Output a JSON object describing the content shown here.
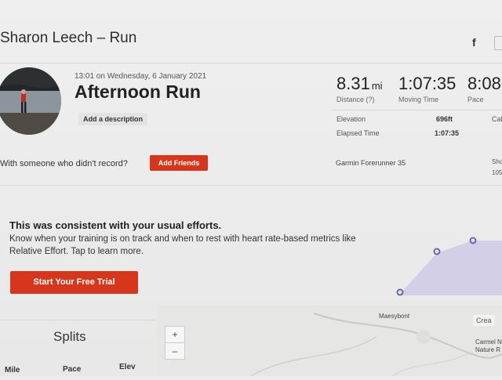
{
  "header": {
    "title": "Sharon Leech – Run",
    "share_icon": "f"
  },
  "activity": {
    "datetime": "13:01 on Wednesday, 6 January 2021",
    "title": "Afternoon Run",
    "add_description": "Add a description"
  },
  "stats": {
    "distance": {
      "value": "8.31",
      "unit": "mi",
      "label": "Distance (?)"
    },
    "moving_time": {
      "value": "1:07:35",
      "label": "Moving Time"
    },
    "pace": {
      "value": "8:08",
      "label": "Pace"
    }
  },
  "details": {
    "elevation_label": "Elevation",
    "elevation_value": "696ft",
    "elapsed_label": "Elapsed Time",
    "elapsed_value": "1:07:35",
    "calories_label": "Cal",
    "device": "Garmin Forerunner 35",
    "shoes_label": "Sho",
    "shoes_value": "105"
  },
  "friends": {
    "prompt": "With someone who didn't record?",
    "button": "Add Friends"
  },
  "effort": {
    "title": "This was consistent with your usual efforts.",
    "body": "Know when your training is on track and when to rest with heart rate-based metrics like Relative Effort. Tap to learn more.",
    "button": "Start Your Free Trial",
    "accent_color": "#d6371c",
    "band_color": "#c9c6e6",
    "point_color": "#6a66b5"
  },
  "splits": {
    "title": "Splits",
    "columns": [
      "Mile",
      "Pace",
      "Elev"
    ]
  },
  "map": {
    "zoom_in": "+",
    "zoom_out": "–",
    "place1": "Maesybont",
    "place2": "Carmel N",
    "place3": "Nature R",
    "create": "Crea"
  }
}
